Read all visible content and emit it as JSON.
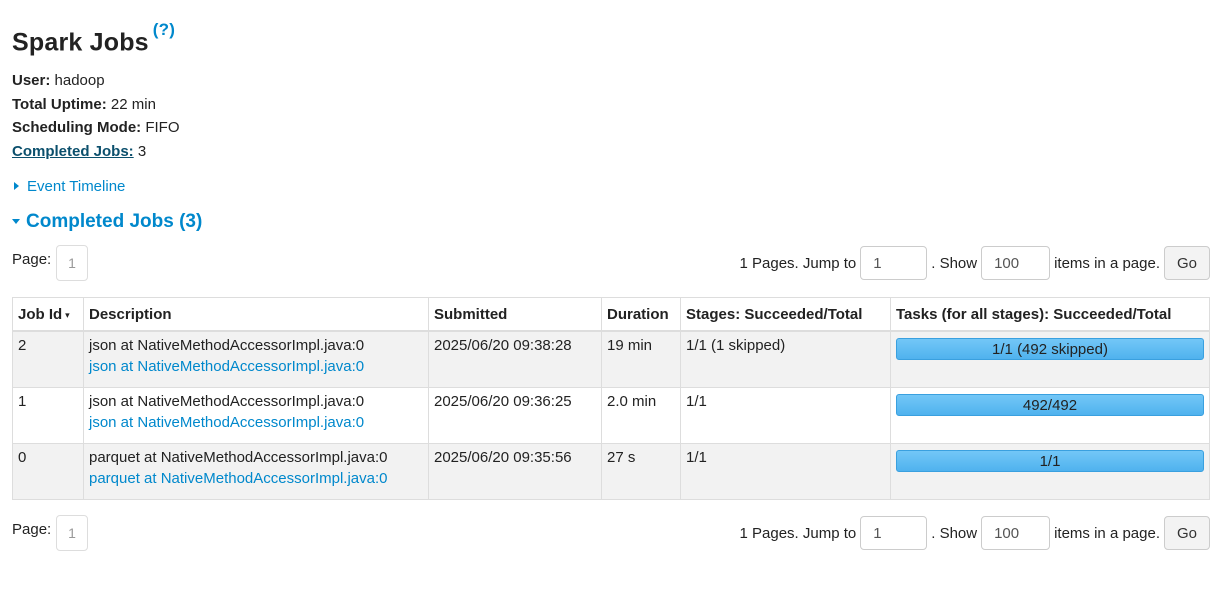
{
  "page": {
    "title": "Spark Jobs",
    "help_mark": "(?)"
  },
  "summary": {
    "user_label": "User:",
    "user_value": "hadoop",
    "uptime_label": "Total Uptime:",
    "uptime_value": "22 min",
    "scheduling_label": "Scheduling Mode:",
    "scheduling_value": "FIFO",
    "completed_label": "Completed Jobs:",
    "completed_value": "3"
  },
  "timeline": {
    "label": "Event Timeline"
  },
  "section": {
    "title": "Completed Jobs (3)"
  },
  "pager": {
    "page_label": "Page:",
    "current_page": "1",
    "pages_text": "1 Pages. Jump to",
    "jump_value": "1",
    "show_text": ". Show",
    "size_value": "100",
    "items_text": "items in a page.",
    "go_label": "Go"
  },
  "table": {
    "headers": {
      "job_id": "Job Id",
      "sort_indicator": "▾",
      "description": "Description",
      "submitted": "Submitted",
      "duration": "Duration",
      "stages": "Stages: Succeeded/Total",
      "tasks": "Tasks (for all stages): Succeeded/Total"
    },
    "rows": [
      {
        "job_id": "2",
        "description": "json at NativeMethodAccessorImpl.java:0",
        "description_link": "json at NativeMethodAccessorImpl.java:0",
        "submitted": "2025/06/20 09:38:28",
        "duration": "19 min",
        "stages": "1/1 (1 skipped)",
        "tasks": "1/1 (492 skipped)",
        "tasks_progress": 1.0
      },
      {
        "job_id": "1",
        "description": "json at NativeMethodAccessorImpl.java:0",
        "description_link": "json at NativeMethodAccessorImpl.java:0",
        "submitted": "2025/06/20 09:36:25",
        "duration": "2.0 min",
        "stages": "1/1",
        "tasks": "492/492",
        "tasks_progress": 1.0
      },
      {
        "job_id": "0",
        "description": "parquet at NativeMethodAccessorImpl.java:0",
        "description_link": "parquet at NativeMethodAccessorImpl.java:0",
        "submitted": "2025/06/20 09:35:56",
        "duration": "27 s",
        "stages": "1/1",
        "tasks": "1/1",
        "tasks_progress": 1.0
      }
    ]
  },
  "colors": {
    "link": "#0088cc",
    "progress": "#66c0f4",
    "row_stripe": "#f2f2f2"
  }
}
